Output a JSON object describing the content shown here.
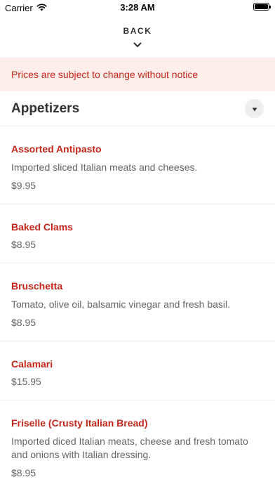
{
  "status_bar": {
    "carrier": "Carrier",
    "time": "3:28 AM",
    "battery_level": 1.0
  },
  "nav": {
    "back_label": "BACK",
    "back_icon": "chevron-down-icon"
  },
  "notice": {
    "text": "Prices are subject to change without notice"
  },
  "section": {
    "title": "Appetizers",
    "toggle_icon": "caret-down-icon"
  },
  "colors": {
    "accent": "#c4261a",
    "notice_background": "#fdeeea",
    "secondary_text": "#666666"
  },
  "items": [
    {
      "name": "Assorted Antipasto",
      "description": "Imported sliced Italian meats and cheeses.",
      "price": "$9.95"
    },
    {
      "name": "Baked Clams",
      "description": "",
      "price": "$8.95"
    },
    {
      "name": "Bruschetta",
      "description": "Tomato, olive oil, balsamic vinegar and fresh basil.",
      "price": "$8.95"
    },
    {
      "name": "Calamari",
      "description": "",
      "price": "$15.95"
    },
    {
      "name": "Friselle (Crusty Italian Bread)",
      "description": "Imported diced Italian meats, cheese and fresh tomato and onions with Italian dressing.",
      "price": "$8.95"
    }
  ]
}
